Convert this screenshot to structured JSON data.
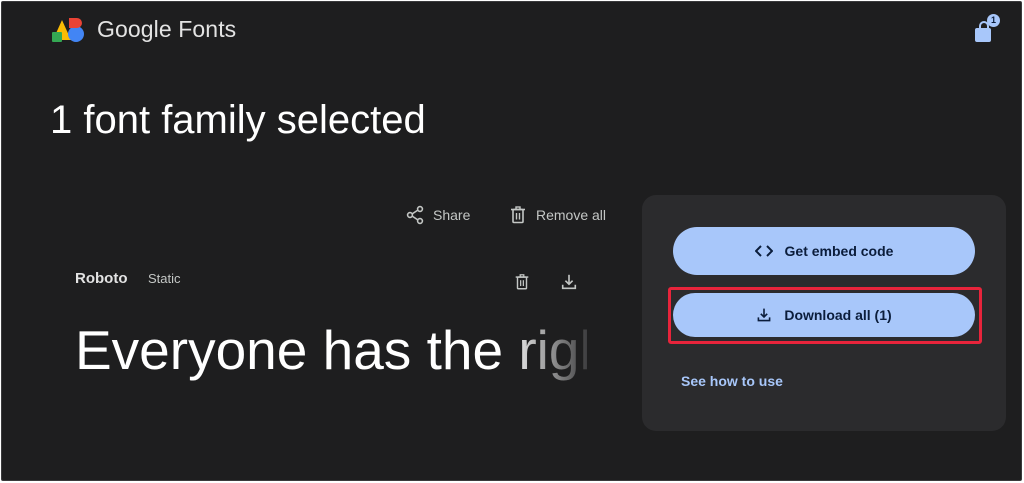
{
  "header": {
    "brand": "Google Fonts",
    "bag_count": "1"
  },
  "main": {
    "title": "1 font family selected",
    "share_label": "Share",
    "remove_all_label": "Remove all"
  },
  "font_card": {
    "name": "Roboto",
    "type": "Static",
    "sample_text": "Everyone has the right"
  },
  "panel": {
    "embed_label": "Get embed code",
    "download_label": "Download all (1)",
    "see_how_label": "See how to use"
  },
  "colors": {
    "background": "#1e1e1f",
    "panel": "#2b2b2d",
    "accent": "#a8c7fa",
    "highlight": "#e8243b"
  },
  "icons": [
    "google-fonts-logo",
    "shopping-bag-icon",
    "share-icon",
    "trash-icon",
    "download-icon",
    "code-icon"
  ]
}
